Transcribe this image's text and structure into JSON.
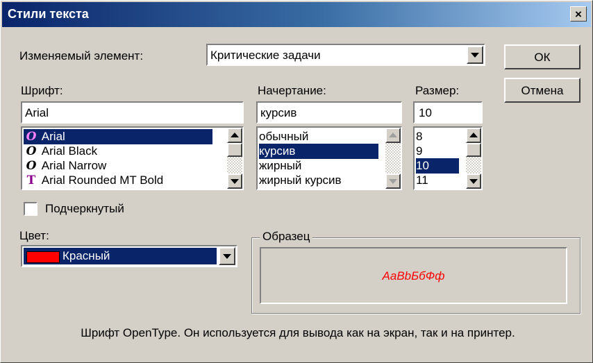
{
  "dialog": {
    "title": "Стили текста",
    "close_label": "×"
  },
  "element_row": {
    "label": "Изменяемый элемент:",
    "selected": "Критические задачи"
  },
  "buttons": {
    "ok": "ОК",
    "cancel": "Отмена"
  },
  "font": {
    "label": "Шрифт:",
    "value": "Arial",
    "items": [
      {
        "label": "Arial",
        "icon": "opentype-icon",
        "glyph": "O",
        "selected": true
      },
      {
        "label": "Arial Black",
        "icon": "opentype-icon",
        "glyph": "O",
        "selected": false
      },
      {
        "label": "Arial Narrow",
        "icon": "opentype-icon",
        "glyph": "O",
        "selected": false
      },
      {
        "label": "Arial Rounded MT Bold",
        "icon": "truetype-icon",
        "glyph": "T",
        "selected": false
      }
    ]
  },
  "style": {
    "label": "Начертание:",
    "value": "курсив",
    "items": [
      {
        "label": "обычный",
        "selected": false
      },
      {
        "label": "курсив",
        "selected": true
      },
      {
        "label": "жирный",
        "selected": false
      },
      {
        "label": "жирный курсив",
        "selected": false
      }
    ]
  },
  "size": {
    "label": "Размер:",
    "value": "10",
    "items": [
      {
        "label": "8",
        "selected": false
      },
      {
        "label": "9",
        "selected": false
      },
      {
        "label": "10",
        "selected": true
      },
      {
        "label": "11",
        "selected": false
      }
    ]
  },
  "underline": {
    "label": "Подчеркнутый",
    "checked": false
  },
  "color": {
    "label": "Цвет:",
    "selected": "Красный",
    "swatch": "#ff0000"
  },
  "sample": {
    "label": "Образец",
    "text": "AaBbБбФф",
    "text_color": "#ff0000"
  },
  "description": "Шрифт OpenType. Он используется для вывода как на экран, так и на принтер.",
  "colors": {
    "selection": "#0a246a",
    "face": "#d4d0c8",
    "opentype_icon": "#8b008b",
    "truetype_icon": "#8b008b"
  }
}
